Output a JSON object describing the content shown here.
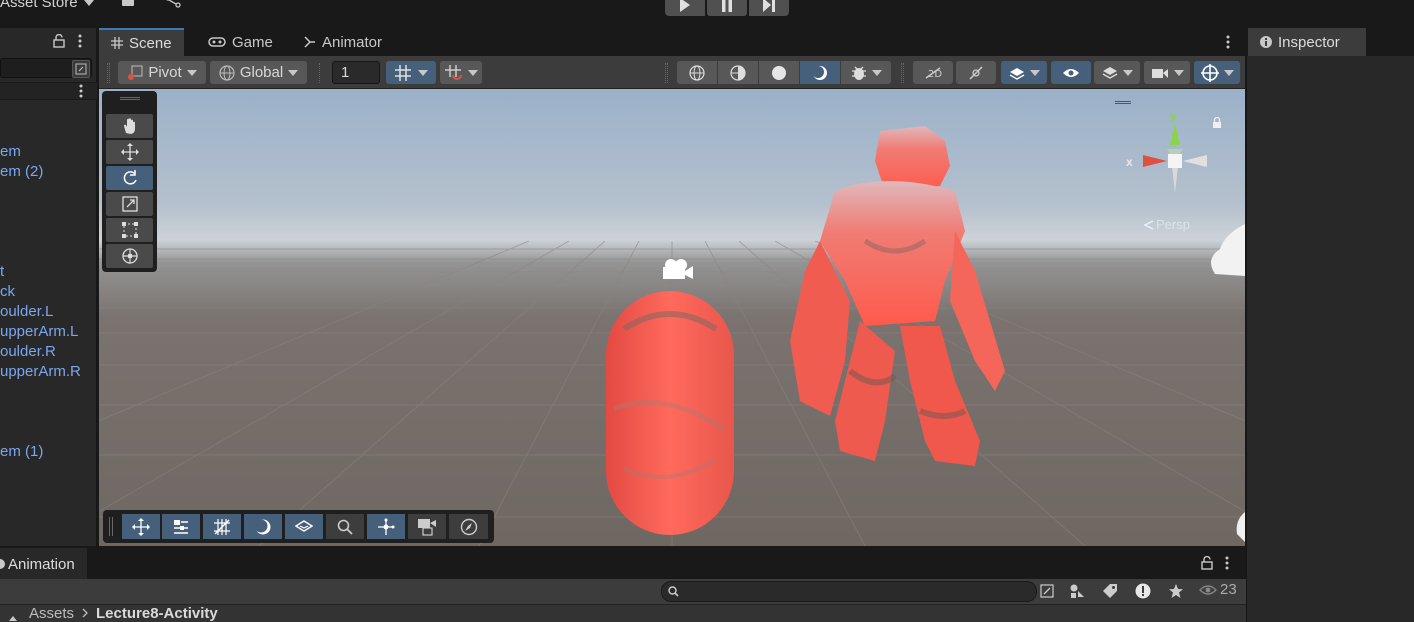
{
  "top_bar": {
    "asset_store_label": "Asset Store"
  },
  "hierarchy": {
    "items": [
      "em",
      "em (2)",
      "t",
      "ck",
      "oulder.L",
      "upperArm.L",
      "oulder.R",
      "upperArm.R",
      "em (1)"
    ]
  },
  "scene_tabs": [
    {
      "label": "Scene",
      "icon": "grid-icon"
    },
    {
      "label": "Game",
      "icon": "gamepad-icon"
    },
    {
      "label": "Animator",
      "icon": "animator-icon"
    }
  ],
  "scene_toolbar": {
    "pivot_label": "Pivot",
    "global_label": "Global",
    "grid_size_value": "1"
  },
  "orientation_gizmo": {
    "y_label": "y",
    "x_label": "x",
    "persp_label": "Persp"
  },
  "inspector": {
    "tab_label": "Inspector"
  },
  "bottom_panel": {
    "tab_label": "Animation",
    "visible_count": "23",
    "breadcrumb": [
      "Assets",
      "Lecture8-Activity"
    ]
  },
  "colors": {
    "accent_blue": "#46607c",
    "link_blue": "#7ba6f0",
    "highlight_red": "#ff5a5a"
  }
}
